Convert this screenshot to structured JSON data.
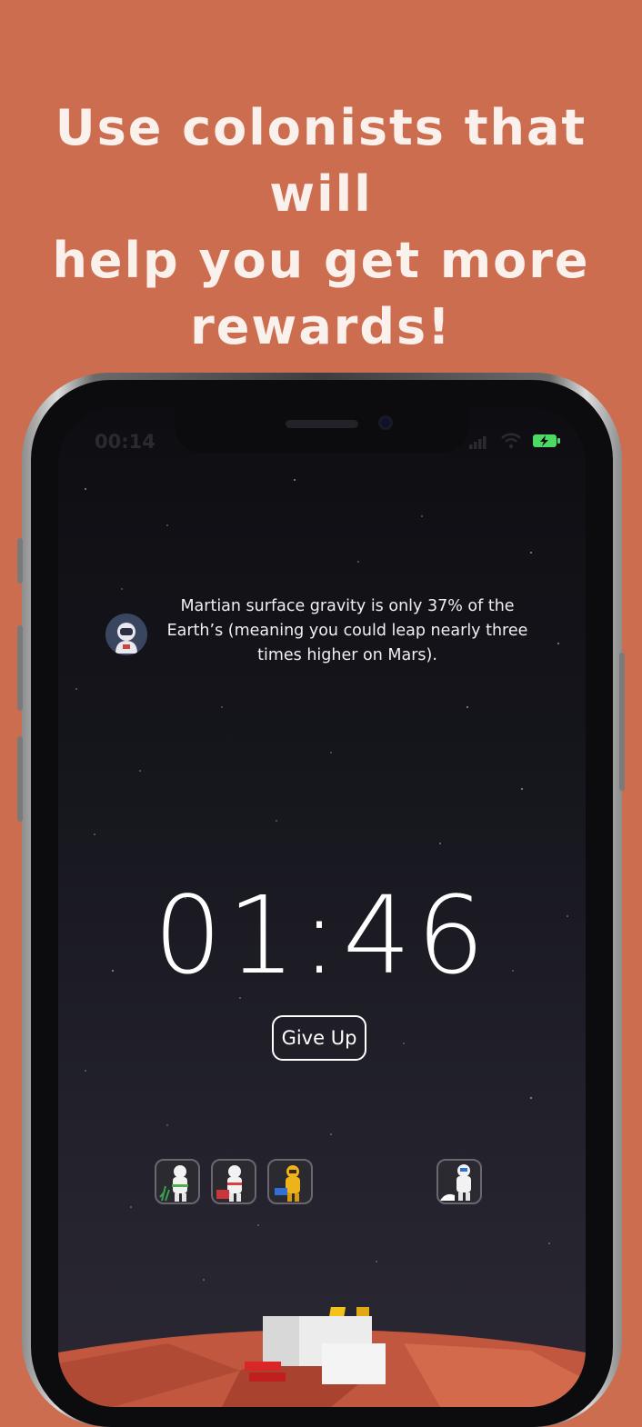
{
  "promo": {
    "headline_line1": "Use colonists that will",
    "headline_line2": "help you get more",
    "headline_line3": "rewards!"
  },
  "status_bar": {
    "time": "00:14"
  },
  "fact": {
    "avatar_icon": "astronaut-icon",
    "text": "Martian surface gravity is only 37% of the Earth’s (meaning you could leap nearly three times higher on Mars)."
  },
  "timer": {
    "value": "01:46"
  },
  "actions": {
    "give_up_label": "Give Up"
  },
  "colonists": [
    {
      "icon": "botanist-colonist-icon"
    },
    {
      "icon": "engineer-colonist-icon"
    },
    {
      "icon": "technician-colonist-icon"
    },
    {
      "icon": "builder-colonist-icon"
    }
  ],
  "colors": {
    "background": "#cc6d4f",
    "battery": "#4cd964",
    "crane": "#f5c21a"
  }
}
